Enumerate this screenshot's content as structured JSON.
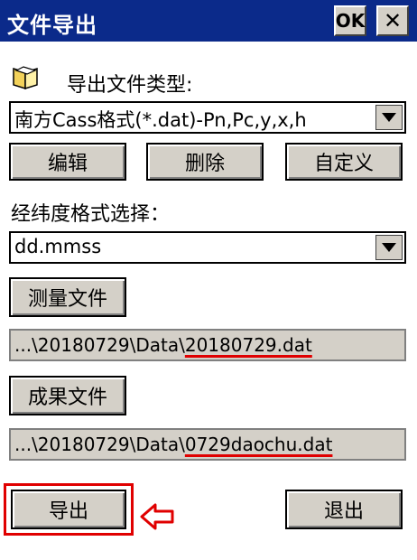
{
  "window": {
    "title": "文件导出",
    "ok_label": "OK",
    "close_label": "✕"
  },
  "export_type": {
    "label": "导出文件类型:",
    "selected": "南方Cass格式(*.dat)-Pn,Pc,y,x,h"
  },
  "type_buttons": {
    "edit": "编辑",
    "delete": "删除",
    "custom": "自定义"
  },
  "latlon_format": {
    "label": "经纬度格式选择：",
    "selected": "dd.mmss"
  },
  "survey_file": {
    "button": "测量文件",
    "path_prefix": "...\\20180729\\Data\\",
    "file_name": "20180729.dat"
  },
  "result_file": {
    "button": "成果文件",
    "path_prefix": "...\\20180729\\Data\\",
    "file_name": "0729daochu.dat"
  },
  "actions": {
    "export": "导出",
    "exit": "退出"
  },
  "colors": {
    "titlebar": "#0b2a8a",
    "annotation": "#e00000",
    "button_face": "#d4d0c8"
  },
  "icons": {
    "export_type": "book-icon",
    "annotation_arrow": "left-arrow-icon"
  }
}
